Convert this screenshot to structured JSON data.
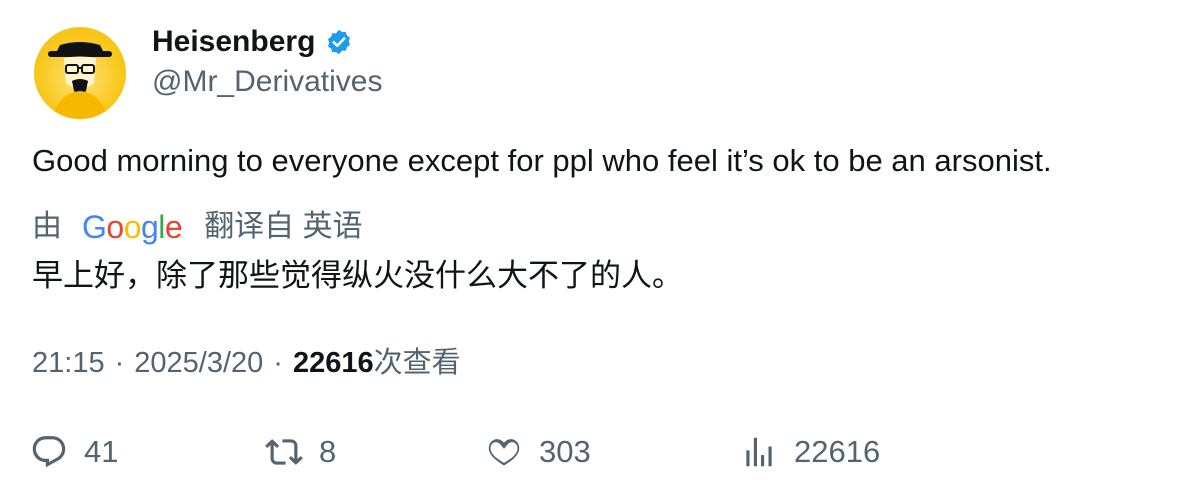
{
  "author": {
    "name": "Heisenberg",
    "handle": "@Mr_Derivatives",
    "verified": true,
    "avatar_icon": "heisenberg-avatar-icon"
  },
  "tweet": {
    "text": "Good morning to everyone except for ppl who feel it’s ok to be an arsonist."
  },
  "translation": {
    "prefix": "由",
    "provider_logo": [
      "G",
      "o",
      "o",
      "g",
      "l",
      "e"
    ],
    "suffix": "翻译自 英语",
    "text": "早上好，除了那些觉得纵火没什么大不了的人。"
  },
  "meta": {
    "time": "21:15",
    "separator": "·",
    "date": "2025/3/20",
    "views_count": "22616",
    "views_label": "次查看"
  },
  "actions": {
    "replies": "41",
    "retweets": "8",
    "likes": "303",
    "views": "22616"
  },
  "colors": {
    "verified_blue": "#1d9bf0",
    "secondary_text": "#536471",
    "primary_text": "#0f1419",
    "google_blue": "#4285f4",
    "google_red": "#ea4335",
    "google_yellow": "#fbbc05",
    "google_green": "#34a853"
  }
}
